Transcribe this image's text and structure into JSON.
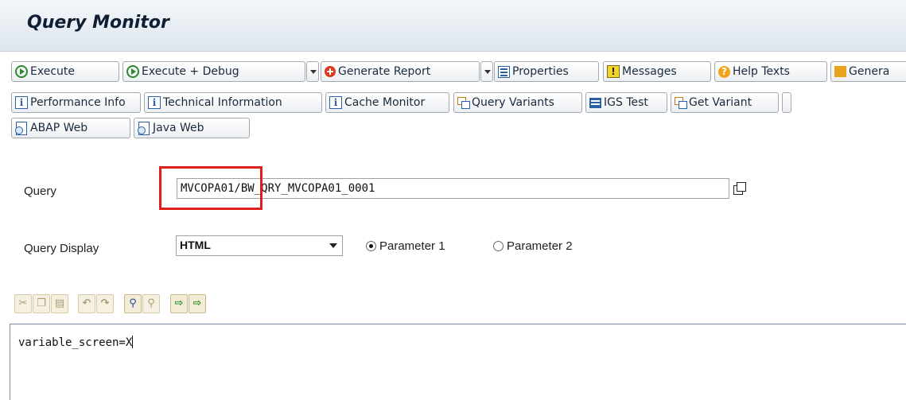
{
  "window": {
    "title": "Query Monitor"
  },
  "toolbar": {
    "row1": [
      {
        "label": "Execute",
        "icon": "execute-icon"
      },
      {
        "label": "Execute + Debug",
        "icon": "execute-icon"
      },
      {
        "label": "Generate Report",
        "icon": "generate-report-icon"
      },
      {
        "label": "Properties",
        "icon": "properties-icon"
      },
      {
        "label": "Messages",
        "icon": "messages-icon"
      },
      {
        "label": "Help Texts",
        "icon": "help-icon"
      },
      {
        "label": "Genera",
        "icon": "generate-icon"
      }
    ],
    "row2": [
      {
        "label": "Performance Info",
        "icon": "info-icon"
      },
      {
        "label": "Technical Information",
        "icon": "info-icon"
      },
      {
        "label": "Cache Monitor",
        "icon": "info-icon"
      },
      {
        "label": "Query Variants",
        "icon": "variants-icon"
      },
      {
        "label": "IGS Test",
        "icon": "igs-icon"
      },
      {
        "label": "Get Variant",
        "icon": "variants-icon"
      }
    ],
    "row3": [
      {
        "label": "ABAP Web",
        "icon": "web-icon"
      },
      {
        "label": "Java Web",
        "icon": "web-icon"
      }
    ]
  },
  "form": {
    "query_label": "Query",
    "query_value": "MVCOPA01/BW_QRY_MVCOPA01_0001",
    "display_label": "Query Display",
    "display_value": "HTML",
    "radio1_label": "Parameter 1",
    "radio2_label": "Parameter 2",
    "radio_selected": "Parameter 1"
  },
  "editor": {
    "text": "variable_screen=X",
    "toolbar_icons": [
      "cut-icon",
      "copy-icon",
      "paste-icon",
      "undo-icon",
      "redo-icon",
      "find-icon",
      "find-next-icon",
      "import-icon",
      "export-icon"
    ]
  },
  "colors": {
    "highlight": "#e01e1e",
    "title_bar": "#dde5ed"
  }
}
